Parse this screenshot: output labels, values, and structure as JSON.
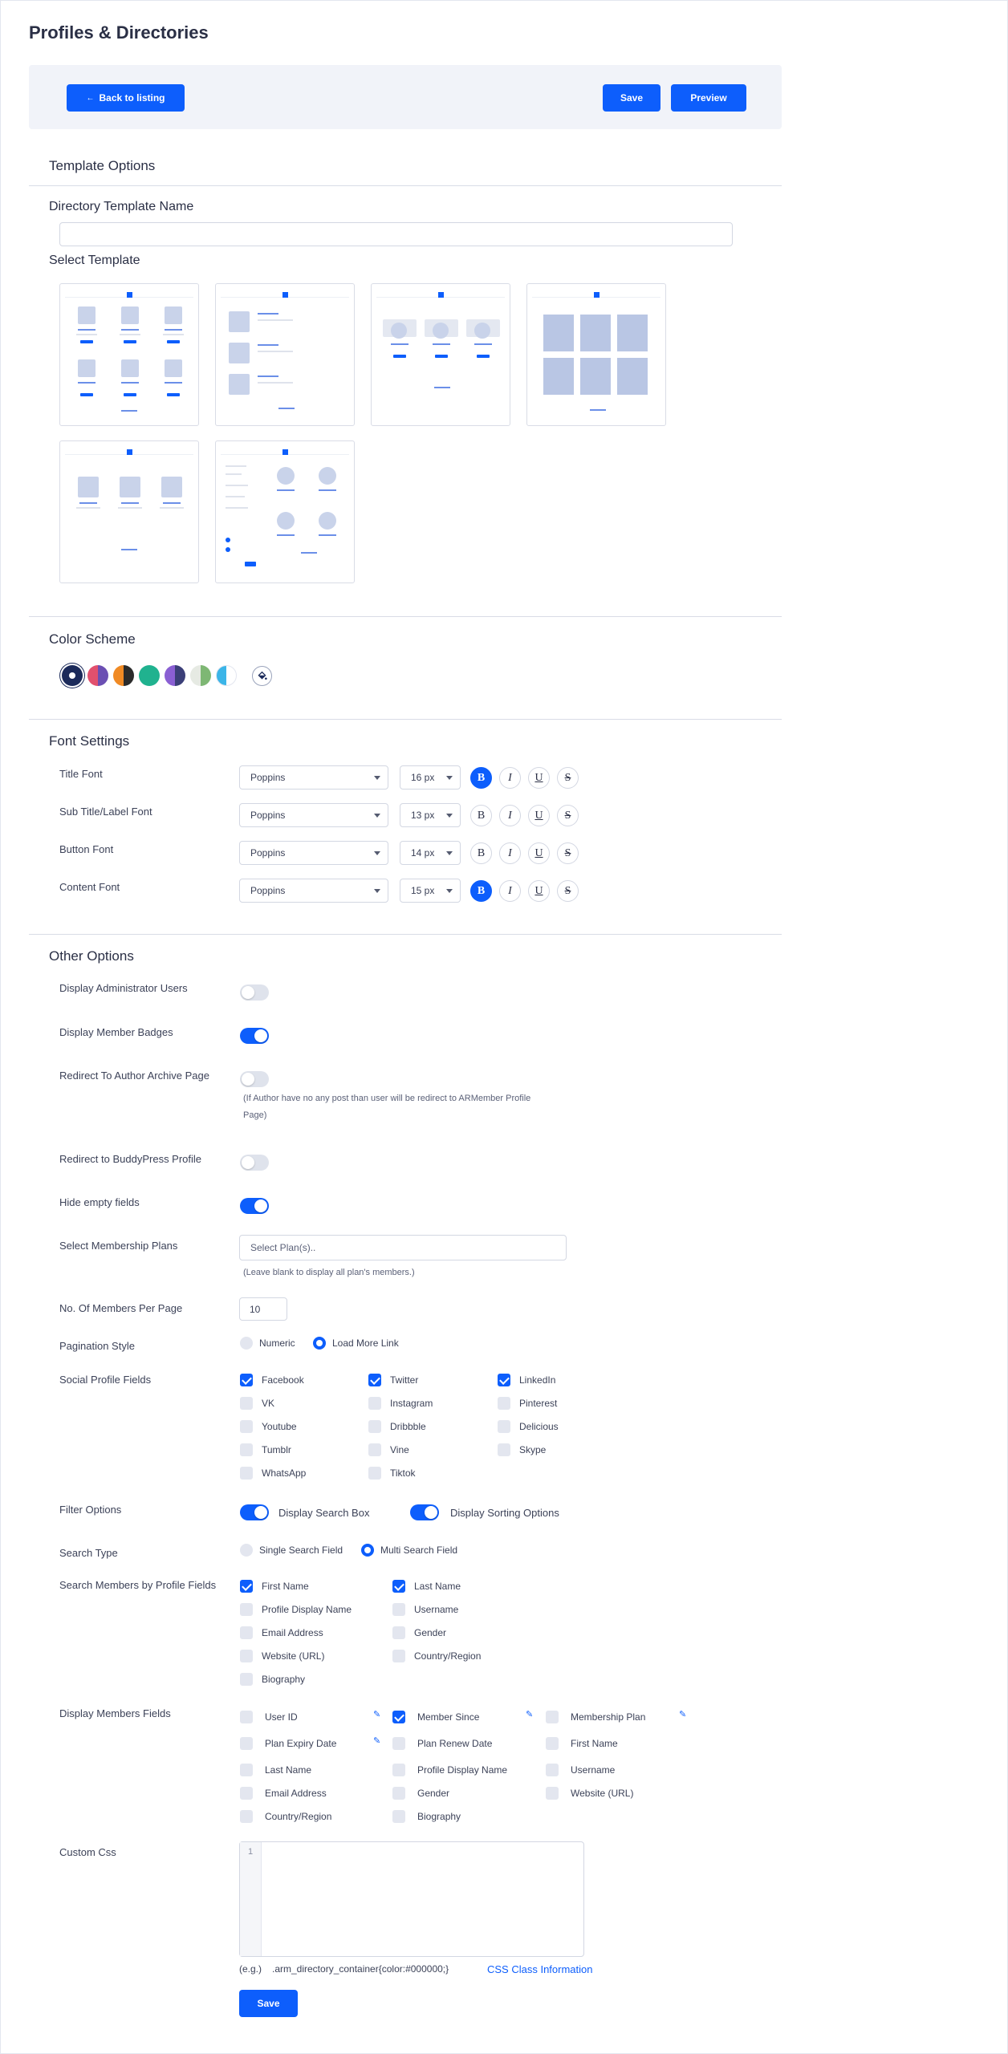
{
  "page": {
    "title": "Profiles & Directories"
  },
  "toolbar": {
    "back_label": "Back to listing",
    "save_label": "Save",
    "preview_label": "Preview",
    "back_icon": "arrow-left-icon"
  },
  "template_options": {
    "title": "Template Options",
    "name_label": "Directory Template Name",
    "name_value": "",
    "select_label": "Select Template"
  },
  "color_scheme": {
    "title": "Color Scheme",
    "swatches": [
      {
        "a": "#1b2a5a",
        "b": "#1b2a5a",
        "selected": true
      },
      {
        "a": "#e2506e",
        "b": "#6b4fb3"
      },
      {
        "a": "#f08a24",
        "b": "#2b2b2b"
      },
      {
        "a": "#20b28f",
        "b": "#20b28f"
      },
      {
        "a": "#8a5fd3",
        "b": "#3b3f78"
      },
      {
        "a": "#e6eae3",
        "b": "#7eb774"
      },
      {
        "a": "#3bb5e8",
        "b": "#ffffff"
      }
    ],
    "custom_icon": "paint-bucket-icon"
  },
  "font_settings": {
    "title": "Font Settings",
    "rows": [
      {
        "label": "Title Font",
        "font": "Poppins",
        "size": "16 px",
        "bold": true
      },
      {
        "label": "Sub Title/Label Font",
        "font": "Poppins",
        "size": "13 px",
        "bold": false
      },
      {
        "label": "Button Font",
        "font": "Poppins",
        "size": "14 px",
        "bold": false
      },
      {
        "label": "Content Font",
        "font": "Poppins",
        "size": "15 px",
        "bold": true
      }
    ],
    "style_glyphs": {
      "bold": "B",
      "italic": "I",
      "underline": "U",
      "strike": "S"
    }
  },
  "other_options": {
    "title": "Other Options",
    "display_admin": {
      "label": "Display Administrator Users",
      "on": false
    },
    "display_badges": {
      "label": "Display Member Badges",
      "on": true
    },
    "redirect_author": {
      "label": "Redirect To Author Archive Page",
      "on": false,
      "note_1": "(If Author have no any post than user will be redirect to ARMember Profile",
      "note_2": "Page)"
    },
    "redirect_buddypress": {
      "label": "Redirect to BuddyPress Profile",
      "on": false
    },
    "hide_empty": {
      "label": "Hide empty fields",
      "on": true
    },
    "membership_plans": {
      "label": "Select Membership Plans",
      "placeholder": "Select Plan(s)..",
      "note": "(Leave blank to display all plan's members.)"
    },
    "members_per_page": {
      "label": "No. Of Members Per Page",
      "value": "10"
    },
    "pagination": {
      "label": "Pagination Style",
      "options": [
        "Numeric",
        "Load More Link"
      ],
      "selected": "Load More Link"
    },
    "social": {
      "label": "Social Profile Fields",
      "items": [
        {
          "name": "Facebook",
          "checked": true
        },
        {
          "name": "Twitter",
          "checked": true
        },
        {
          "name": "LinkedIn",
          "checked": true
        },
        {
          "name": "VK",
          "checked": false
        },
        {
          "name": "Instagram",
          "checked": false
        },
        {
          "name": "Pinterest",
          "checked": false
        },
        {
          "name": "Youtube",
          "checked": false
        },
        {
          "name": "Dribbble",
          "checked": false
        },
        {
          "name": "Delicious",
          "checked": false
        },
        {
          "name": "Tumblr",
          "checked": false
        },
        {
          "name": "Vine",
          "checked": false
        },
        {
          "name": "Skype",
          "checked": false
        },
        {
          "name": "WhatsApp",
          "checked": false
        },
        {
          "name": "Tiktok",
          "checked": false
        }
      ]
    },
    "filter": {
      "label": "Filter Options",
      "search_box": "Display Search Box",
      "sorting": "Display Sorting Options"
    },
    "search_type": {
      "label": "Search Type",
      "options": [
        "Single Search Field",
        "Multi Search Field"
      ],
      "selected": "Multi Search Field"
    },
    "search_fields": {
      "label": "Search Members by Profile Fields",
      "items": [
        {
          "name": "First Name",
          "checked": true
        },
        {
          "name": "Last Name",
          "checked": true
        },
        {
          "name": "Profile Display Name",
          "checked": false
        },
        {
          "name": "Username",
          "checked": false
        },
        {
          "name": "Email Address",
          "checked": false
        },
        {
          "name": "Gender",
          "checked": false
        },
        {
          "name": "Website (URL)",
          "checked": false
        },
        {
          "name": "Country/Region",
          "checked": false
        },
        {
          "name": "Biography",
          "checked": false
        }
      ]
    },
    "display_fields": {
      "label": "Display Members Fields",
      "items": [
        {
          "name": "User ID",
          "checked": false,
          "edit": true
        },
        {
          "name": "Member Since",
          "checked": true,
          "edit": true
        },
        {
          "name": "Membership Plan",
          "checked": false,
          "edit": true
        },
        {
          "name": "Plan Expiry Date",
          "checked": false,
          "edit": true
        },
        {
          "name": "Plan Renew Date",
          "checked": false
        },
        {
          "name": "First Name",
          "checked": false
        },
        {
          "name": "Last Name",
          "checked": false
        },
        {
          "name": "Profile Display Name",
          "checked": false
        },
        {
          "name": "Username",
          "checked": false
        },
        {
          "name": "Email Address",
          "checked": false
        },
        {
          "name": "Gender",
          "checked": false
        },
        {
          "name": "Website (URL)",
          "checked": false
        },
        {
          "name": "Country/Region",
          "checked": false
        },
        {
          "name": "Biography",
          "checked": false
        }
      ]
    },
    "custom_css": {
      "label": "Custom Css",
      "line_number": "1",
      "example_prefix": "(e.g.)",
      "example": ".arm_directory_container{color:#000000;}",
      "link": "CSS Class Information"
    },
    "save_label": "Save"
  }
}
